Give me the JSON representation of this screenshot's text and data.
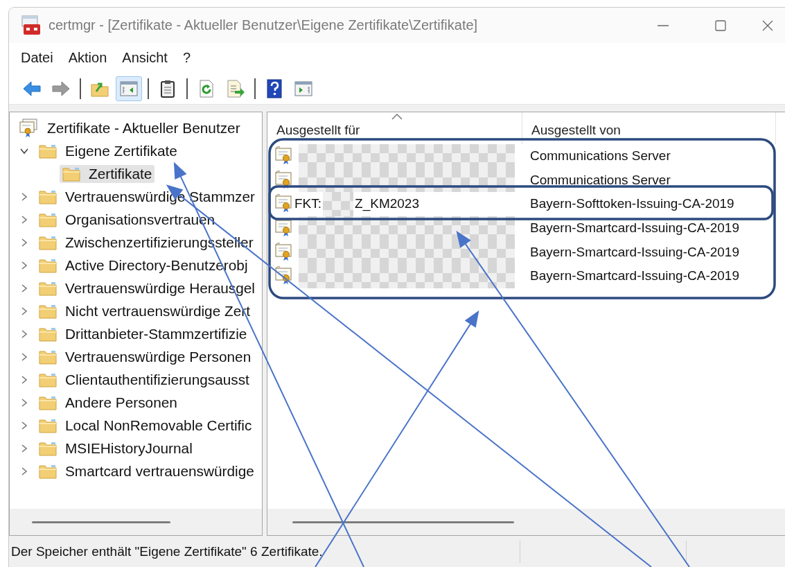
{
  "window": {
    "title": "certmgr - [Zertifikate - Aktueller Benutzer\\Eigene Zertifikate\\Zertifikate]"
  },
  "menu": [
    {
      "label": "Datei"
    },
    {
      "label": "Aktion"
    },
    {
      "label": "Ansicht"
    },
    {
      "label": "?"
    }
  ],
  "toolbar": [
    [
      {
        "kind": "back",
        "on": false,
        "disabled": false
      },
      {
        "kind": "forward",
        "on": false,
        "disabled": true
      }
    ],
    [
      {
        "kind": "up",
        "on": false,
        "disabled": false
      },
      {
        "kind": "tree-toggle",
        "on": true,
        "disabled": false
      }
    ],
    [
      {
        "kind": "clipboard",
        "on": false,
        "disabled": false
      }
    ],
    [
      {
        "kind": "refresh",
        "on": false,
        "disabled": false
      },
      {
        "kind": "export",
        "on": false,
        "disabled": false
      }
    ],
    [
      {
        "kind": "help",
        "on": false,
        "disabled": false
      },
      {
        "kind": "pane-toggle",
        "on": false,
        "disabled": false
      }
    ]
  ],
  "tree": [
    {
      "label": "Zertifikate - Aktueller Benutzer",
      "kind": "store",
      "selected": false,
      "children": [
        {
          "label": "Eigene Zertifikate",
          "kind": "folder",
          "expanded": true,
          "selected": false,
          "children": [
            {
              "label": "Zertifikate",
              "kind": "folder",
              "selected": true
            }
          ]
        },
        {
          "label": "Vertrauenswürdige Stammzer",
          "kind": "folder",
          "expanded": false,
          "selected": false
        },
        {
          "label": "Organisationsvertrauen",
          "kind": "folder",
          "expanded": false,
          "selected": false
        },
        {
          "label": "Zwischenzertifizierungssteller",
          "kind": "folder",
          "expanded": false,
          "selected": false
        },
        {
          "label": "Active Directory-Benutzerobj",
          "kind": "folder",
          "expanded": false,
          "selected": false
        },
        {
          "label": "Vertrauenswürdige Herausgel",
          "kind": "folder",
          "expanded": false,
          "selected": false
        },
        {
          "label": "Nicht vertrauenswürdige Zert",
          "kind": "folder",
          "expanded": false,
          "selected": false
        },
        {
          "label": "Drittanbieter-Stammzertifizie",
          "kind": "folder",
          "expanded": false,
          "selected": false
        },
        {
          "label": "Vertrauenswürdige Personen",
          "kind": "folder",
          "expanded": false,
          "selected": false
        },
        {
          "label": "Clientauthentifizierungsausst",
          "kind": "folder",
          "expanded": false,
          "selected": false
        },
        {
          "label": "Andere Personen",
          "kind": "folder",
          "expanded": false,
          "selected": false
        },
        {
          "label": "Local NonRemovable Certific",
          "kind": "folder",
          "expanded": false,
          "selected": false
        },
        {
          "label": "MSIEHistoryJournal",
          "kind": "folder",
          "expanded": false,
          "selected": false
        },
        {
          "label": "Smartcard vertrauenswürdige",
          "kind": "folder",
          "expanded": false,
          "selected": false
        }
      ]
    }
  ],
  "list": {
    "columns": [
      {
        "label": "Ausgestellt für",
        "sorted": true
      },
      {
        "label": "Ausgestellt von",
        "sorted": false
      }
    ],
    "rows": [
      {
        "issued_to": [
          {
            "kind": "redacted"
          }
        ],
        "issued_by": "Communications Server"
      },
      {
        "issued_to": [
          {
            "kind": "redacted"
          }
        ],
        "issued_by": "Communications Server"
      },
      {
        "issued_to": [
          {
            "kind": "text",
            "text": "FKT:"
          },
          {
            "kind": "redacted"
          },
          {
            "kind": "text",
            "text": "Z_KM2023"
          }
        ],
        "issued_by": "Bayern-Softtoken-Issuing-CA-2019"
      },
      {
        "issued_to": [
          {
            "kind": "redacted"
          }
        ],
        "issued_by": "Bayern-Smartcard-Issuing-CA-2019"
      },
      {
        "issued_to": [
          {
            "kind": "redacted"
          }
        ],
        "issued_by": "Bayern-Smartcard-Issuing-CA-2019"
      },
      {
        "issued_to": [
          {
            "kind": "redacted"
          }
        ],
        "issued_by": "Bayern-Smartcard-Issuing-CA-2019"
      }
    ]
  },
  "status_bar": {
    "text": "Der Speicher enthält \"Eigene Zertifikate\" 6 Zertifikate."
  }
}
